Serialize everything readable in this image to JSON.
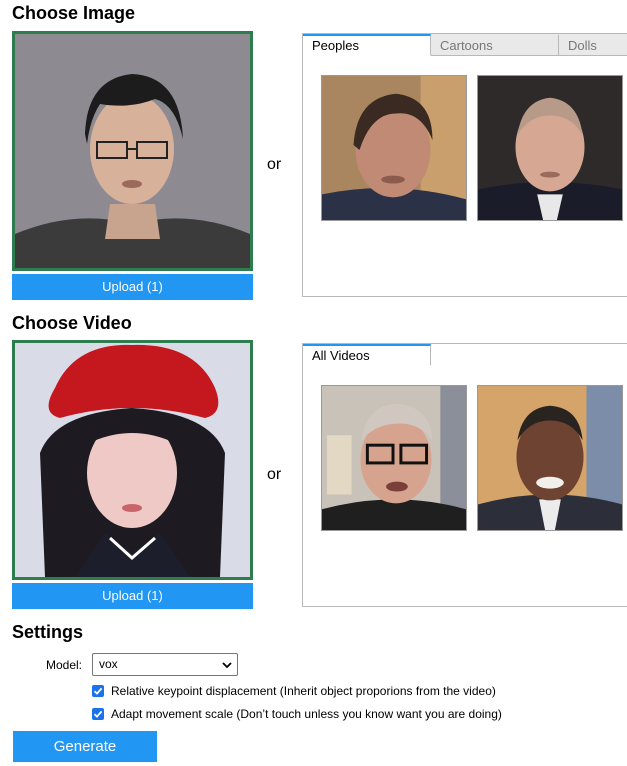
{
  "image_section": {
    "title": "Choose Image",
    "upload_label": "Upload (1)",
    "or_label": "or",
    "tabs": [
      {
        "label": "Peoples",
        "active": true
      },
      {
        "label": "Cartoons",
        "active": false
      },
      {
        "label": "Dolls",
        "active": false
      }
    ]
  },
  "video_section": {
    "title": "Choose Video",
    "upload_label": "Upload (1)",
    "or_label": "or",
    "tabs": [
      {
        "label": "All Videos",
        "active": true
      }
    ]
  },
  "settings": {
    "title": "Settings",
    "model_label": "Model:",
    "model_value": "vox",
    "options": [
      {
        "label": "Relative keypoint displacement (Inherit object proporions from the video)",
        "checked": true
      },
      {
        "label": "Adapt movement scale (Don’t touch unless you know want you are doing)",
        "checked": true
      }
    ]
  },
  "generate_label": "Generate",
  "colors": {
    "accent": "#2196f3",
    "selected_border": "#2e7d4f"
  }
}
